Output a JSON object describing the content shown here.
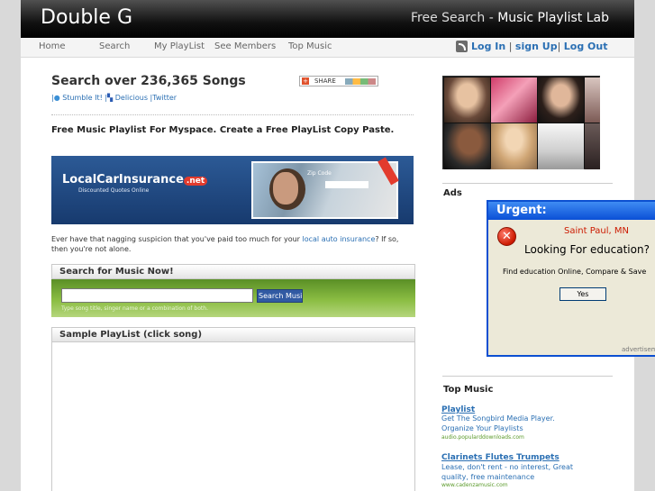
{
  "site": {
    "logo": "Double G",
    "tagline_lead": "Free Search - ",
    "tagline_main": "Music Playlist Lab"
  },
  "nav": {
    "items": [
      "Home",
      "Search",
      "My PlayList",
      "See Members",
      "Top Music"
    ],
    "login": "Log In",
    "signup": "sign Up",
    "logout": "Log Out",
    "rss_icon": "rss-icon"
  },
  "main": {
    "heading": "Search over 236,365 Songs",
    "share_label": "SHARE",
    "social": {
      "stumble": "Stumble It!",
      "delicious": "Delicious",
      "twitter": "Twitter"
    },
    "intro": "Free Music Playlist For Myspace. Create a Free PlayList Copy Paste.",
    "ad": {
      "brand": "LocalCarInsurance",
      "brand_suffix": ".net",
      "sub": "Discounted Quotes Online",
      "zip_label": "Zip Code"
    },
    "body_before": "Ever have that nagging suspicion that you've paid too much for your ",
    "body_link": "local auto insurance",
    "body_after": "? If so, then you're not alone.",
    "search_panel_title": "Search for Music Now!",
    "search_input_value": "",
    "search_button": "Search Music",
    "search_hint": "Type song title, singer name or a combination of both.",
    "playlist_title": "Sample PlayList (click song)"
  },
  "sidebar": {
    "ads_label": "Ads",
    "popup": {
      "title": "Urgent:",
      "location": "Saint Paul, MN",
      "question": "Looking For education?",
      "message": "Find education Online, Compare & Save",
      "yes": "Yes",
      "footer": "advertisement"
    },
    "top_music_title": "Top Music",
    "top_music": [
      {
        "title": "Playlist",
        "desc": "Get The Songbird Media Player. Organize Your Playlists",
        "url": "audio.popularddownloads.com"
      },
      {
        "title": "Clarinets Flutes Trumpets",
        "desc": "Lease, don't rent - no interest, Great quality, free maintenance",
        "url": "www.cadenzamusic.com"
      }
    ]
  },
  "colors": {
    "top_bar": "#000000",
    "link": "#2a6fb3",
    "search_panel": "#7fb03a",
    "popup_title": "#0a4fd6",
    "alert_red": "#cc1a00"
  }
}
